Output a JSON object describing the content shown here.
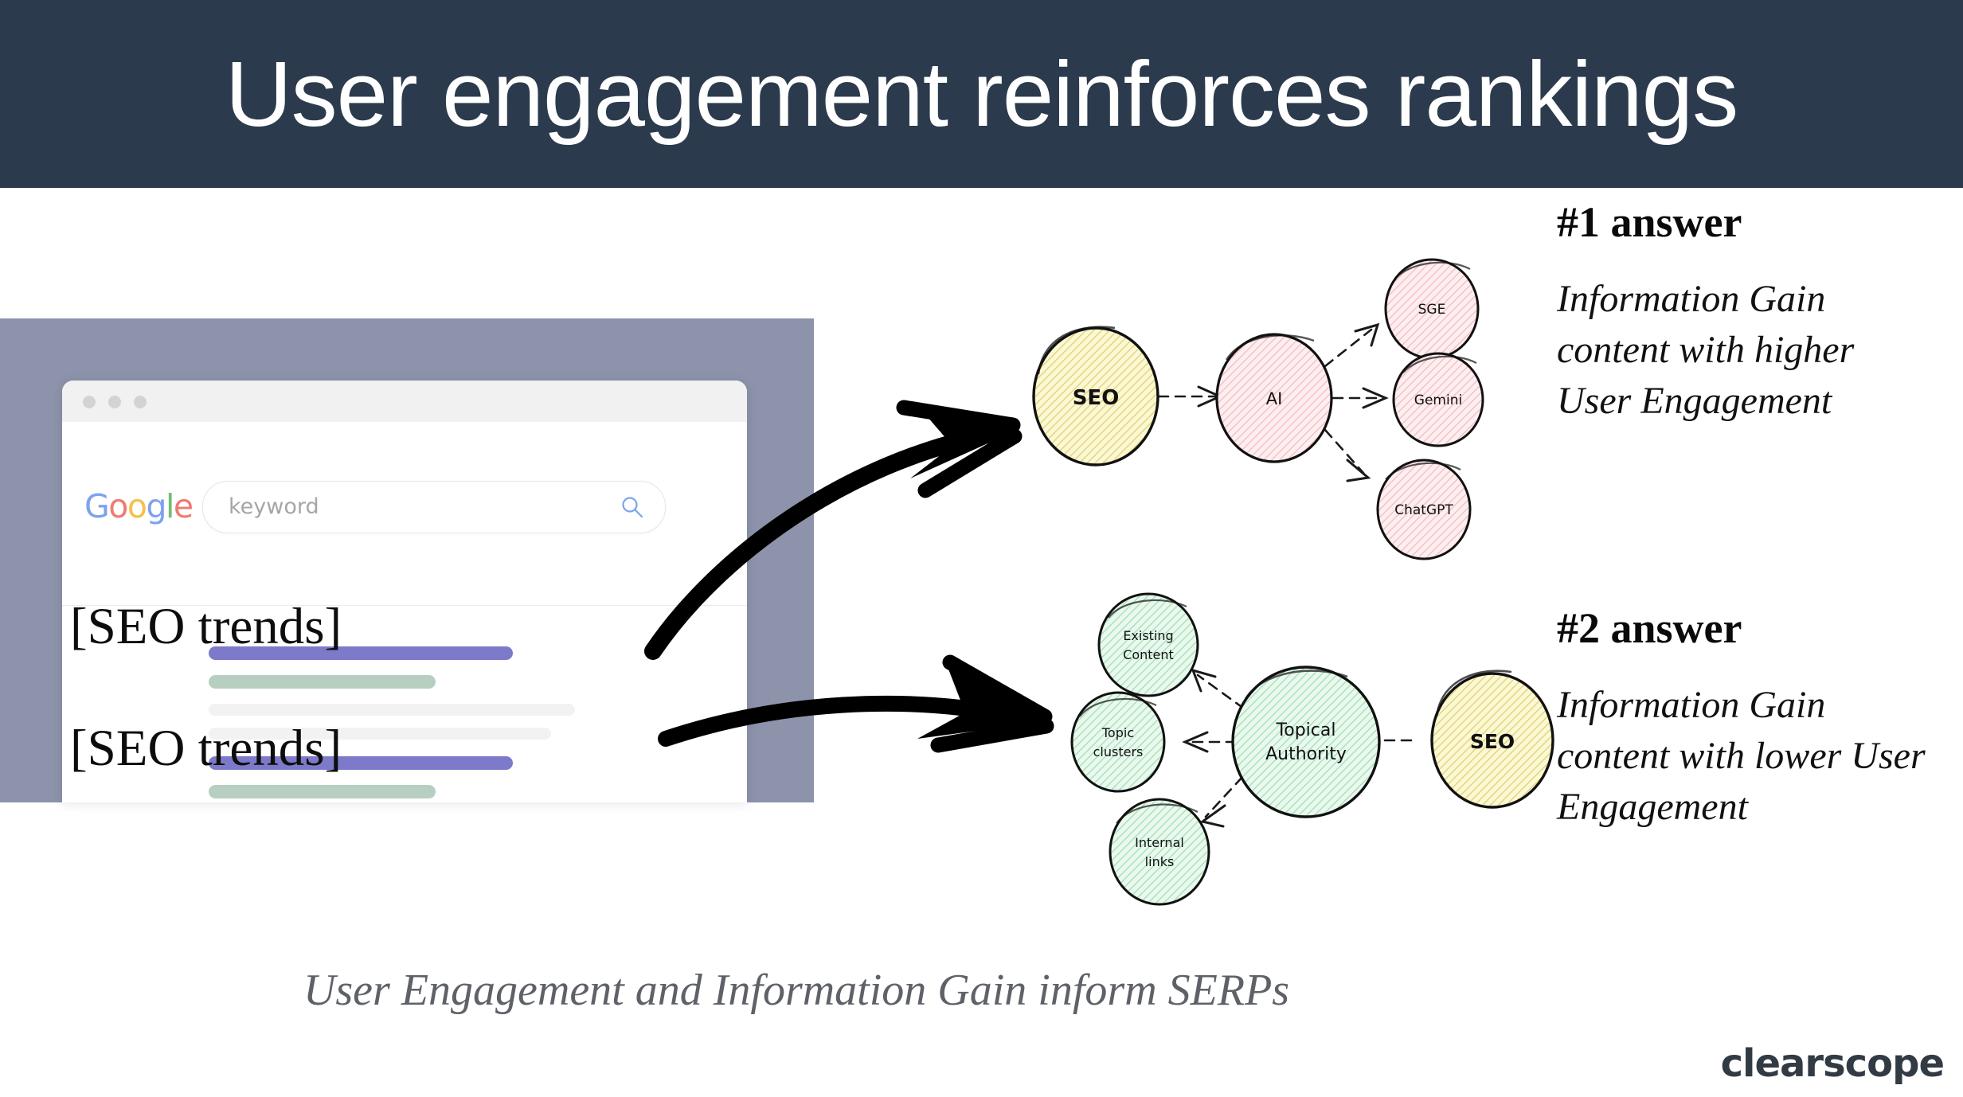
{
  "header": {
    "title": "User engagement reinforces rankings",
    "bg_color": "#2b3b4d",
    "text_color": "#ffffff"
  },
  "browser": {
    "google_logo": {
      "letters": [
        {
          "char": "G",
          "color": "#7da2ee"
        },
        {
          "char": "o",
          "color": "#ef7b72"
        },
        {
          "char": "o",
          "color": "#f5c04e"
        },
        {
          "char": "g",
          "color": "#7da2ee"
        },
        {
          "char": "l",
          "color": "#6dbf6d"
        },
        {
          "char": "e",
          "color": "#ef7b72"
        }
      ],
      "text": "Google"
    },
    "search": {
      "value": "",
      "placeholder": "keyword",
      "icon": "search-icon",
      "icon_color": "#7da2ee"
    },
    "window_dots": [
      "dot-1",
      "dot-2",
      "dot-3"
    ],
    "results": [
      {
        "overlay_label": "[SEO trends]",
        "title_bar_color": "#7d7ac9",
        "subtitle_bar_color": "#b7cfc0",
        "body_line_color": "#f2f2f3"
      },
      {
        "overlay_label": "[SEO trends]",
        "title_bar_color": "#7d7ac9",
        "subtitle_bar_color": "#b7cfc0",
        "body_line_color": "#f2f2f3"
      }
    ],
    "panel_color": "#8c93aa"
  },
  "diagram_top": {
    "name": "ai-surfaces-diagram",
    "root": {
      "label": "SEO",
      "fill": "#fbf8d3",
      "hatch": "#e4dc8a"
    },
    "hub": {
      "label": "AI",
      "fill": "#fdeef0",
      "hatch": "#f2b8bf"
    },
    "leaves": [
      {
        "label": "SGE",
        "fill": "#fdeef0",
        "hatch": "#f2b8bf"
      },
      {
        "label": "Gemini",
        "fill": "#fdeef0",
        "hatch": "#f2b8bf"
      },
      {
        "label": "ChatGPT",
        "fill": "#fdeef0",
        "hatch": "#f2b8bf"
      }
    ],
    "edge_style": "dashed-arrow"
  },
  "diagram_bottom": {
    "name": "topical-authority-diagram",
    "root": {
      "label": "SEO",
      "fill": "#fbf8d3",
      "hatch": "#e4dc8a"
    },
    "hub": {
      "label": "Topical Authority",
      "label_line1": "Topical",
      "label_line2": "Authority",
      "fill": "#eaf8ee",
      "hatch": "#97dfae"
    },
    "leaves": [
      {
        "label": "Existing Content",
        "label_line1": "Existing",
        "label_line2": "Content",
        "fill": "#eaf8ee",
        "hatch": "#97dfae"
      },
      {
        "label": "Topic clusters",
        "label_line1": "Topic",
        "label_line2": "clusters",
        "fill": "#eaf8ee",
        "hatch": "#97dfae"
      },
      {
        "label": "Internal links",
        "label_line1": "Internal",
        "label_line2": "links",
        "fill": "#eaf8ee",
        "hatch": "#97dfae"
      }
    ],
    "edge_style": "dashed-arrow"
  },
  "answers": [
    {
      "heading": "#1 answer",
      "body": "Information Gain content with higher User Engagement"
    },
    {
      "heading": "#2 answer",
      "body": "Information Gain content with lower User Engagement"
    }
  ],
  "caption": "User Engagement and Information Gain inform SERPs",
  "brand": "clearscope",
  "arrows": [
    {
      "name": "arrow-to-top-diagram",
      "color": "#000000"
    },
    {
      "name": "arrow-to-bottom-diagram",
      "color": "#000000"
    }
  ]
}
